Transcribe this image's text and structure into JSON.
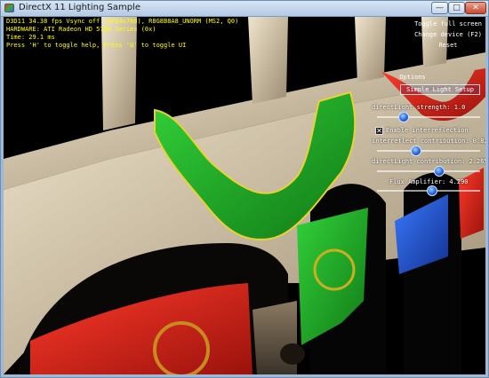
{
  "window": {
    "title": "DirectX 11 Lighting Sample",
    "minimize_glyph": "—",
    "maximize_glyph": "□",
    "close_glyph": "✕"
  },
  "hud": {
    "line1": "D3D11 34.38 fps Vsync off (1024x768), R8G8B8A8_UNORM (MS2, Q0)",
    "line2": "HARDWARE: ATI Radeon HD 5700 Series (0x)",
    "line3": "Time: 29.1 ms",
    "line4": "Press 'H' to toggle help, Press 'U' to toggle UI"
  },
  "controls": {
    "toggle_fullscreen": "Toggle full screen",
    "change_device": "Change device (F2)",
    "reset": "Reset",
    "options": "Options",
    "preset_dropdown": "Simple Light Setup",
    "direct_light_strength": "directLight strength: 1.0",
    "enable_interreflection": "Enable interreflection",
    "interreflect_contribution": "interreflect contribution: 0.829",
    "direct_light_contribution": "directLight contribution: 2.265",
    "flux_amplifier": "Flux Amplifier: 4.290"
  },
  "values": {
    "direct_light_strength": 1.0,
    "interreflect_contribution": 0.829,
    "direct_light_contribution": 2.265,
    "flux_amplifier": 4.29,
    "enable_interreflection_checked": true
  },
  "colors": {
    "hud_text": "#ffff00",
    "slider_thumb": "#1e5bd8",
    "banner_green": "#1fa823",
    "banner_red": "#d8231c",
    "banner_blue": "#1f4fd8",
    "stone": "#d8cbb0"
  }
}
